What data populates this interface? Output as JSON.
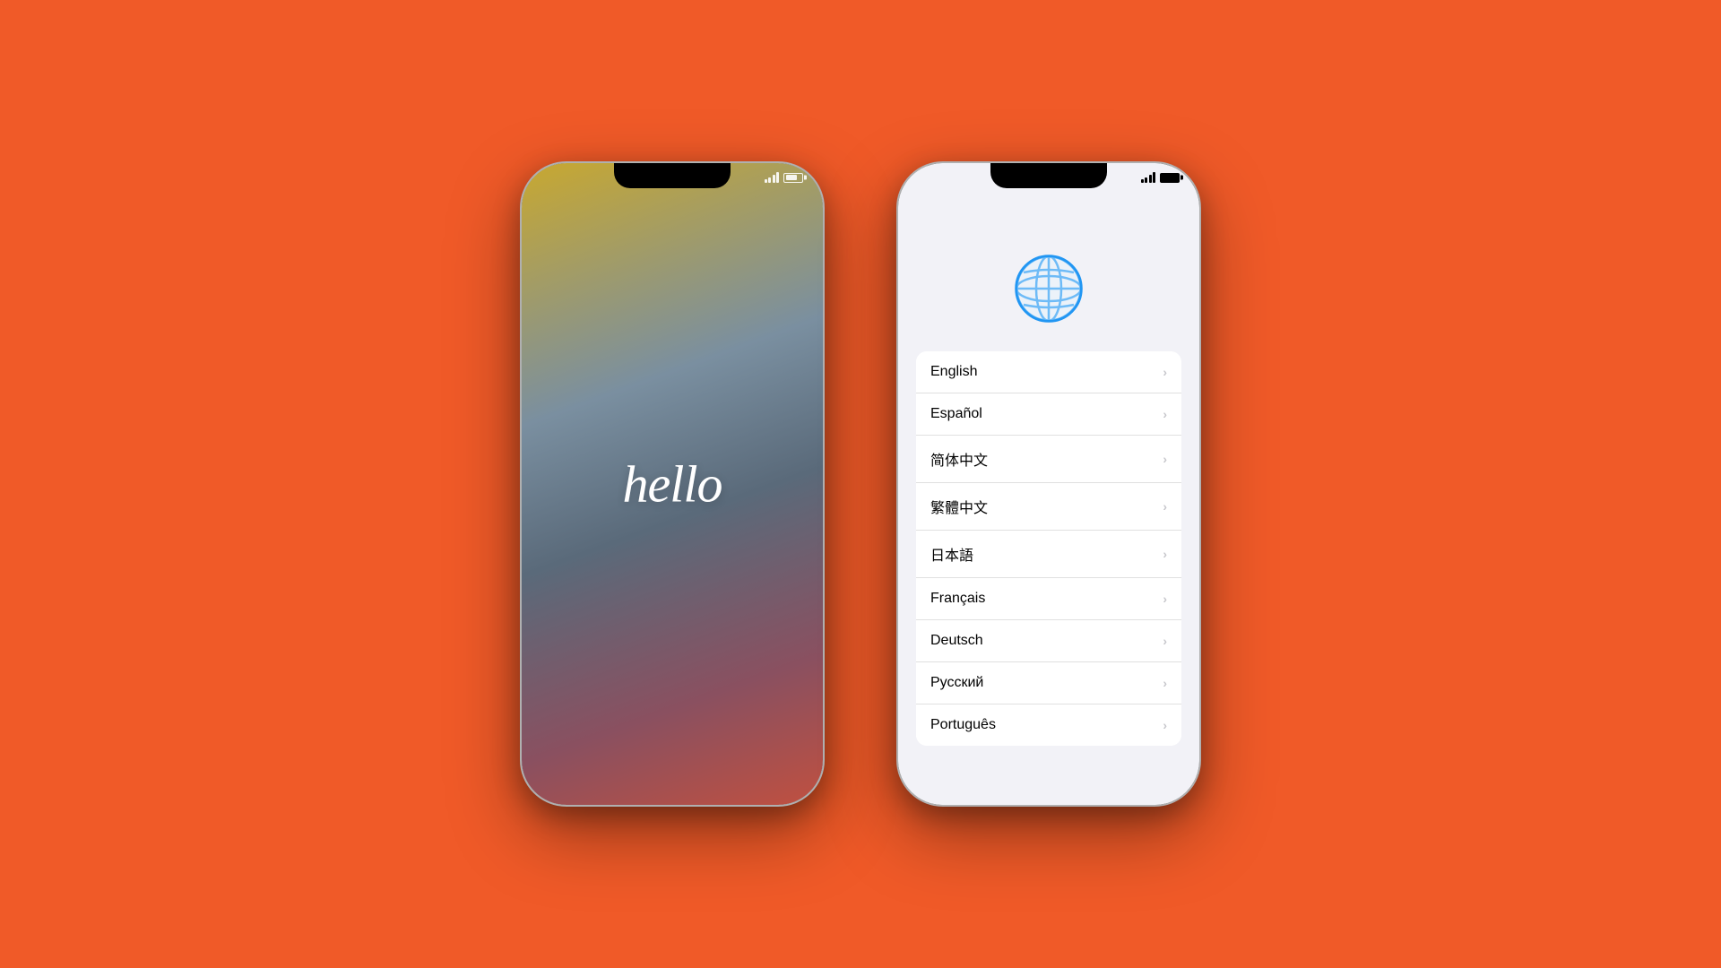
{
  "background": {
    "color": "#F05A28"
  },
  "phone_hello": {
    "hello_text": "hello",
    "status": {
      "signal": "signal",
      "battery": "battery"
    }
  },
  "phone_language": {
    "globe_label": "globe-icon",
    "status": {
      "signal": "signal",
      "battery": "battery"
    },
    "languages": [
      {
        "name": "English"
      },
      {
        "name": "Español"
      },
      {
        "name": "简体中文"
      },
      {
        "name": "繁體中文"
      },
      {
        "name": "日本語"
      },
      {
        "name": "Français"
      },
      {
        "name": "Deutsch"
      },
      {
        "name": "Русский"
      },
      {
        "name": "Português"
      }
    ]
  }
}
